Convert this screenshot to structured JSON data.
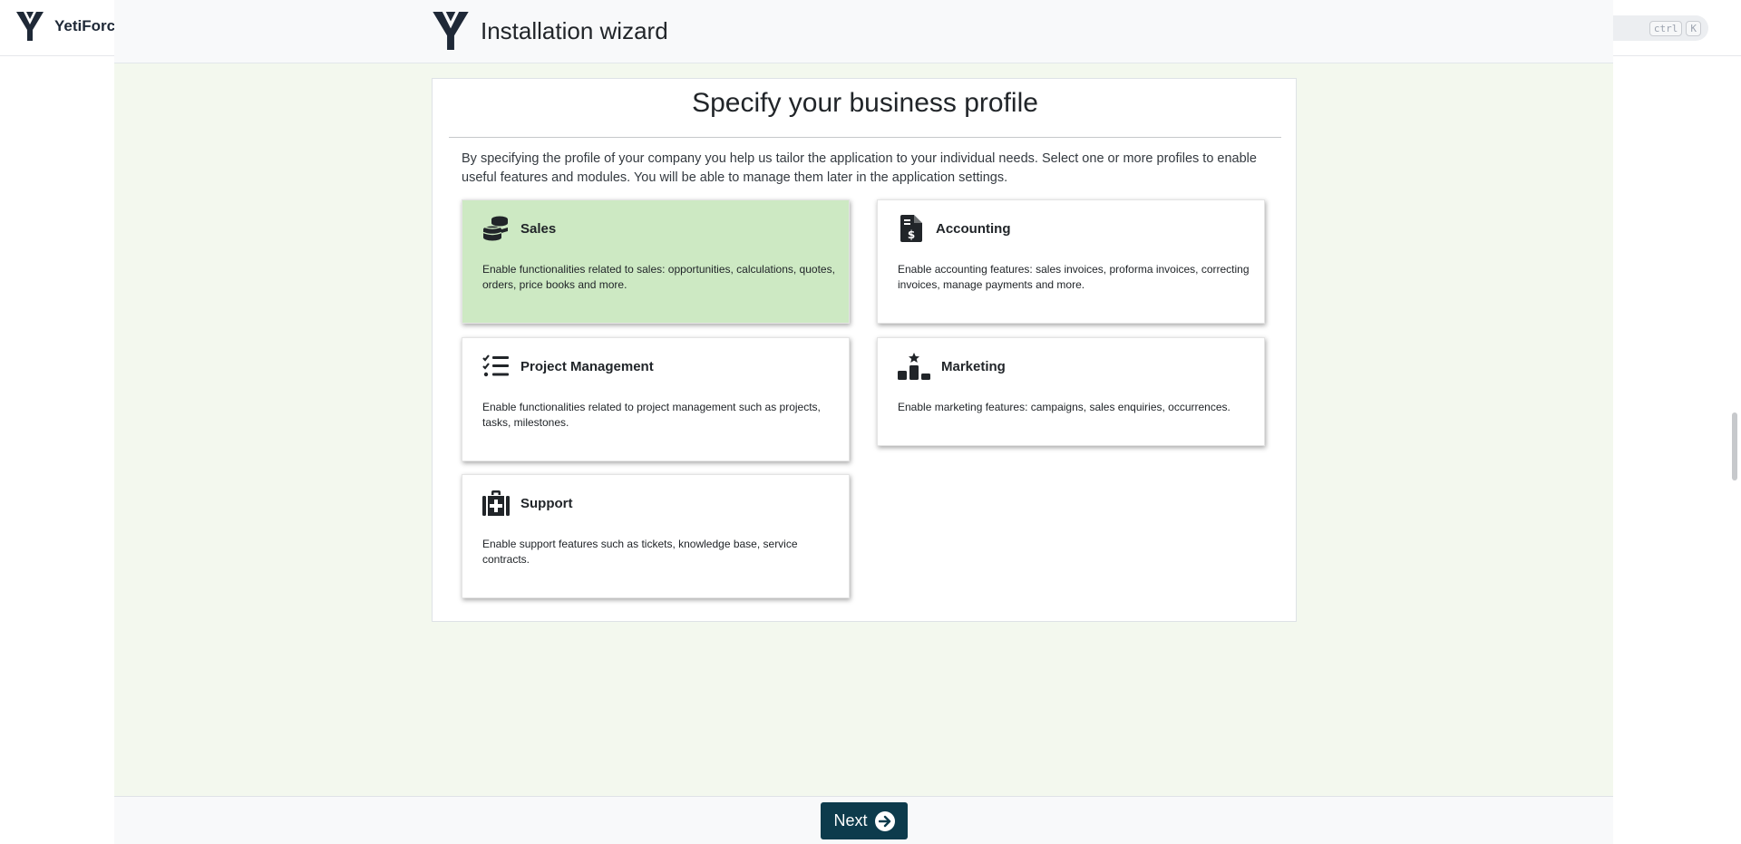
{
  "background_page": {
    "logo_text": "YetiForce",
    "search_kbd": [
      "ctrl",
      "K"
    ]
  },
  "wizard": {
    "title": "Installation wizard",
    "heading": "Specify your business profile",
    "description": "By specifying the profile of your company you help us tailor the application to your individual needs. Select one or more profiles to enable useful features and modules. You will be able to manage them later in the application settings.",
    "profiles": [
      {
        "name": "Sales",
        "icon": "coins-icon",
        "selected": true,
        "description": "Enable functionalities related to sales: opportunities, calculations, quotes, orders, price books and more."
      },
      {
        "name": "Accounting",
        "icon": "invoice-dollar-icon",
        "selected": false,
        "description": "Enable accounting features: sales invoices, proforma invoices, correcting invoices, manage payments and more."
      },
      {
        "name": "Project Management",
        "icon": "tasks-list-icon",
        "selected": false,
        "description": "Enable functionalities related to project management such as projects, tasks, milestones."
      },
      {
        "name": "Marketing",
        "icon": "podium-star-icon",
        "selected": false,
        "description": "Enable marketing features: campaigns, sales enquiries, occurrences."
      },
      {
        "name": "Support",
        "icon": "medkit-icon",
        "selected": false,
        "description": "Enable support features such as tickets, knowledge base, service contracts."
      }
    ],
    "next_label": "Next"
  },
  "colors": {
    "selected_card": "#cde9c3",
    "wizard_background": "#f3f8ee",
    "next_button": "#0d3b4c"
  }
}
